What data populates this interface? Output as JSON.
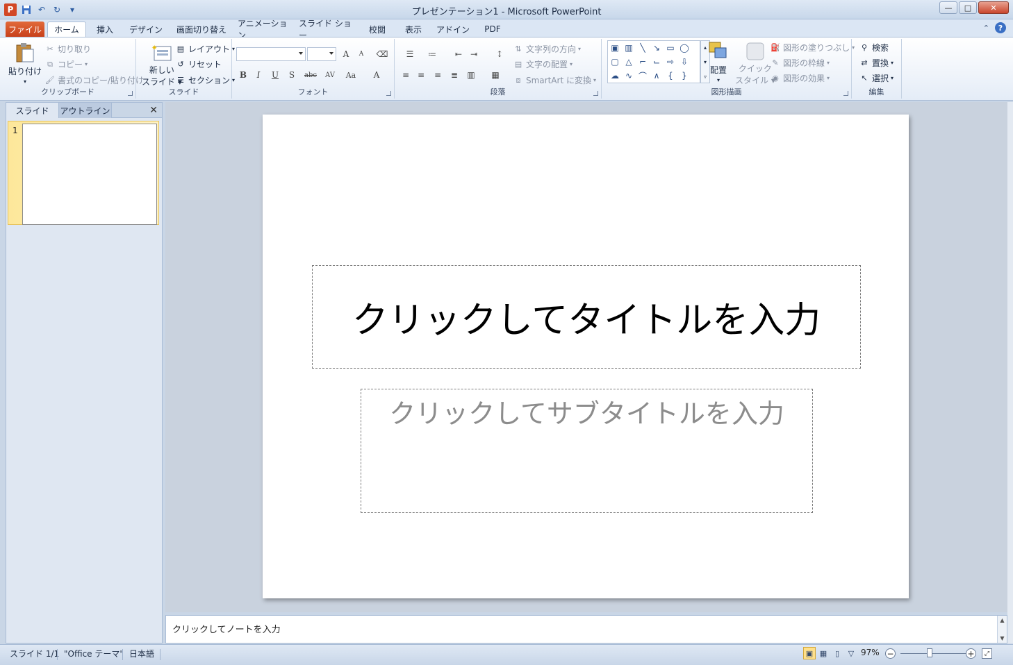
{
  "titlebar": {
    "app_icon": "P",
    "title": "プレゼンテーション1  -  Microsoft PowerPoint",
    "minimize": "—",
    "maximize": "□",
    "close": "✕"
  },
  "tabs": [
    "ファイル",
    "ホーム",
    "挿入",
    "デザイン",
    "画面切り替え",
    "アニメーション",
    "スライド ショー",
    "校閲",
    "表示",
    "アドイン",
    "PDF"
  ],
  "active_tab": "ホーム",
  "help": "?",
  "ribbon": {
    "clipboard": {
      "label": "クリップボード",
      "paste": "貼り付け",
      "cut": "切り取り",
      "copy": "コピー",
      "format_painter": "書式のコピー/貼り付け"
    },
    "slides": {
      "label": "スライド",
      "new_slide_1": "新しい",
      "new_slide_2": "スライド",
      "layout": "レイアウト",
      "reset": "リセット",
      "section": "セクション"
    },
    "font": {
      "label": "フォント",
      "bold": "B",
      "italic": "I",
      "underline": "U",
      "shadow": "S",
      "strike": "abc",
      "spacing": "AV",
      "case": "Aa",
      "color": "A",
      "grow": "A",
      "shrink": "A"
    },
    "paragraph": {
      "label": "段落",
      "text_direction": "文字列の方向",
      "align_text": "文字の配置",
      "smartart": "SmartArt に変換"
    },
    "drawing": {
      "label": "図形描画",
      "arrange": "配置",
      "quick_styles_1": "クイック",
      "quick_styles_2": "スタイル",
      "fill": "図形の塗りつぶし",
      "outline": "図形の枠線",
      "effects": "図形の効果"
    },
    "editing": {
      "label": "編集",
      "find": "検索",
      "replace": "置換",
      "select": "選択"
    }
  },
  "left_pane": {
    "tab_slides": "スライド",
    "tab_outline": "アウトライン",
    "close": "✕",
    "slide_number": "1"
  },
  "slide": {
    "title_placeholder": "クリックしてタイトルを入力",
    "subtitle_placeholder": "クリックしてサブタイトルを入力"
  },
  "notes": {
    "placeholder": "クリックしてノートを入力"
  },
  "status": {
    "slide": "スライド 1/1",
    "theme": "\"Office テーマ\"",
    "language": "日本語",
    "zoom": "97%",
    "zoom_slider_fraction": 0.4
  }
}
